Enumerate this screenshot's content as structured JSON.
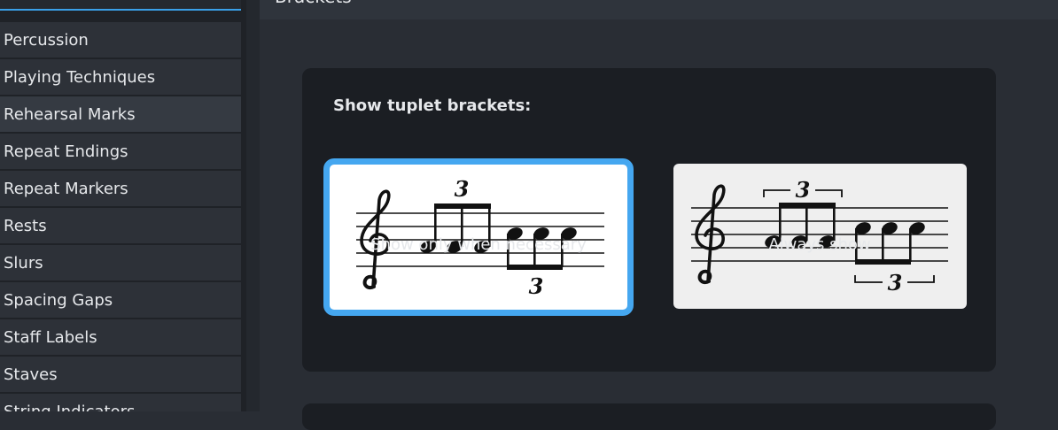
{
  "sidebar": {
    "items": [
      {
        "label": "Percussion"
      },
      {
        "label": "Playing Techniques"
      },
      {
        "label": "Rehearsal Marks"
      },
      {
        "label": "Repeat Endings"
      },
      {
        "label": "Repeat Markers"
      },
      {
        "label": "Rests"
      },
      {
        "label": "Slurs"
      },
      {
        "label": "Spacing Gaps"
      },
      {
        "label": "Staff Labels"
      },
      {
        "label": "Staves"
      },
      {
        "label": "String Indicators"
      }
    ]
  },
  "header": {
    "title": "Brackets"
  },
  "tuplet_section": {
    "heading": "Show tuplet brackets:",
    "options": [
      {
        "label": "Show only when necessary",
        "tuplet_number": "3",
        "selected": true
      },
      {
        "label": "Always show",
        "tuplet_number": "3",
        "selected": false
      }
    ]
  },
  "colors": {
    "accent": "#45a7f0",
    "background": "#292d34",
    "card": "#1b1e23"
  }
}
